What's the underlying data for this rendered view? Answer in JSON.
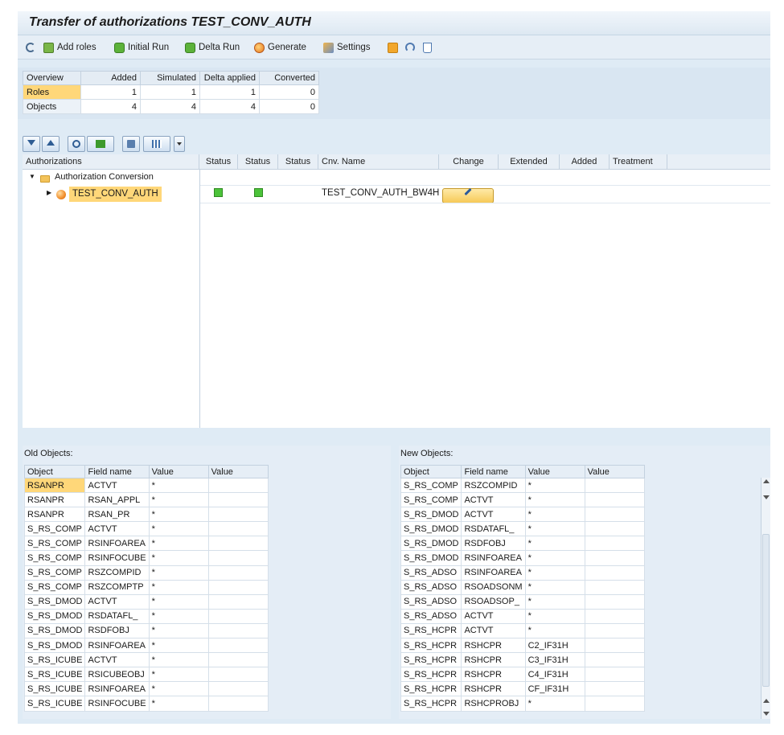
{
  "title": "Transfer of authorizations TEST_CONV_AUTH",
  "toolbar": {
    "add_roles": "Add roles",
    "initial_run": "Initial Run",
    "delta_run": "Delta Run",
    "generate": "Generate",
    "settings": "Settings"
  },
  "overview": {
    "headers": [
      "Overview",
      "Added",
      "Simulated",
      "Delta applied",
      "Converted"
    ],
    "rows": [
      {
        "label": "Roles",
        "added": "1",
        "simulated": "1",
        "delta": "1",
        "converted": "0"
      },
      {
        "label": "Objects",
        "added": "4",
        "simulated": "4",
        "delta": "4",
        "converted": "0"
      }
    ]
  },
  "tree": {
    "headers": {
      "authorizations": "Authorizations",
      "status1": "Status",
      "status2": "Status",
      "status3": "Status",
      "cnv_name": "Cnv. Name",
      "change": "Change",
      "extended": "Extended",
      "added": "Added",
      "treatment": "Treatment"
    },
    "folder_label": "Authorization Conversion",
    "role_label": "TEST_CONV_AUTH",
    "cnv_name": "TEST_CONV_AUTH_BW4H",
    "status_color": "#4cc33a"
  },
  "old_objects": {
    "title": "Old Objects:",
    "headers": [
      "Object",
      "Field name",
      "Value",
      "Value"
    ],
    "rows": [
      [
        "RSANPR",
        "ACTVT",
        "*",
        ""
      ],
      [
        "RSANPR",
        "RSAN_APPL",
        "*",
        ""
      ],
      [
        "RSANPR",
        "RSAN_PR",
        "*",
        ""
      ],
      [
        "S_RS_COMP",
        "ACTVT",
        "*",
        ""
      ],
      [
        "S_RS_COMP",
        "RSINFOAREA",
        "*",
        ""
      ],
      [
        "S_RS_COMP",
        "RSINFOCUBE",
        "*",
        ""
      ],
      [
        "S_RS_COMP",
        "RSZCOMPID",
        "*",
        ""
      ],
      [
        "S_RS_COMP",
        "RSZCOMPTP",
        "*",
        ""
      ],
      [
        "S_RS_DMOD",
        "ACTVT",
        "*",
        ""
      ],
      [
        "S_RS_DMOD",
        "RSDATAFL_",
        "*",
        ""
      ],
      [
        "S_RS_DMOD",
        "RSDFOBJ",
        "*",
        ""
      ],
      [
        "S_RS_DMOD",
        "RSINFOAREA",
        "*",
        ""
      ],
      [
        "S_RS_ICUBE",
        "ACTVT",
        "*",
        ""
      ],
      [
        "S_RS_ICUBE",
        "RSICUBEOBJ",
        "*",
        ""
      ],
      [
        "S_RS_ICUBE",
        "RSINFOAREA",
        "*",
        ""
      ],
      [
        "S_RS_ICUBE",
        "RSINFOCUBE",
        "*",
        ""
      ]
    ]
  },
  "new_objects": {
    "title": "New Objects:",
    "headers": [
      "Object",
      "Field name",
      "Value",
      "Value"
    ],
    "rows": [
      [
        "S_RS_COMP",
        "RSZCOMPID",
        "*",
        ""
      ],
      [
        "S_RS_COMP",
        "ACTVT",
        "*",
        ""
      ],
      [
        "S_RS_DMOD",
        "ACTVT",
        "*",
        ""
      ],
      [
        "S_RS_DMOD",
        "RSDATAFL_",
        "*",
        ""
      ],
      [
        "S_RS_DMOD",
        "RSDFOBJ",
        "*",
        ""
      ],
      [
        "S_RS_DMOD",
        "RSINFOAREA",
        "*",
        ""
      ],
      [
        "S_RS_ADSO",
        "RSINFOAREA",
        "*",
        ""
      ],
      [
        "S_RS_ADSO",
        "RSOADSONM",
        "*",
        ""
      ],
      [
        "S_RS_ADSO",
        "RSOADSOP_",
        "*",
        ""
      ],
      [
        "S_RS_ADSO",
        "ACTVT",
        "*",
        ""
      ],
      [
        "S_RS_HCPR",
        "ACTVT",
        "*",
        ""
      ],
      [
        "S_RS_HCPR",
        "RSHCPR",
        "C2_IF31H",
        ""
      ],
      [
        "S_RS_HCPR",
        "RSHCPR",
        "C3_IF31H",
        ""
      ],
      [
        "S_RS_HCPR",
        "RSHCPR",
        "C4_IF31H",
        ""
      ],
      [
        "S_RS_HCPR",
        "RSHCPR",
        "CF_IF31H",
        ""
      ],
      [
        "S_RS_HCPR",
        "RSHCPROBJ",
        "*",
        ""
      ]
    ]
  }
}
